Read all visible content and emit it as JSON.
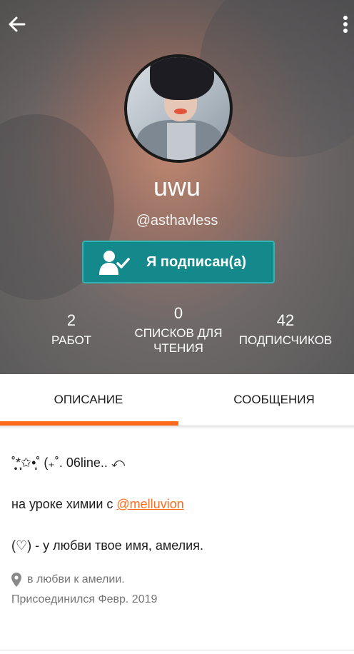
{
  "header": {
    "username": "uwu",
    "handle": "@asthavless",
    "follow_label": "Я подписан(а)"
  },
  "stats": [
    {
      "value": "2",
      "label_line1": "РАБОТ",
      "label_line2": ""
    },
    {
      "value": "0",
      "label_line1": "СПИСКОВ ДЛЯ",
      "label_line2": "ЧТЕНИЯ"
    },
    {
      "value": "42",
      "label_line1": "ПОДПИСЧИКОВ",
      "label_line2": ""
    }
  ],
  "tabs": [
    {
      "label": "ОПИСАНИЕ",
      "active": true
    },
    {
      "label": "СООБЩЕНИЯ",
      "active": false
    }
  ],
  "description": {
    "line1": "˚̩̥̩̥*̩̩͙✩•̩̩͙˚ (₊˚. 06line.. ⤺",
    "line2_prefix": "на уроке химии с ",
    "line2_link": "@melluvion",
    "line3": "(♡) - у любви твое имя, амелия."
  },
  "meta": {
    "location": "в любви к амелии.",
    "joined": "Присоединился Февр. 2019"
  },
  "colors": {
    "accent": "#ff6b1a",
    "follow_button": "#14898b"
  },
  "icons": {
    "back": "arrow-left-icon",
    "more": "more-vertical-icon",
    "follow": "user-check-icon",
    "location": "location-pin-icon"
  }
}
